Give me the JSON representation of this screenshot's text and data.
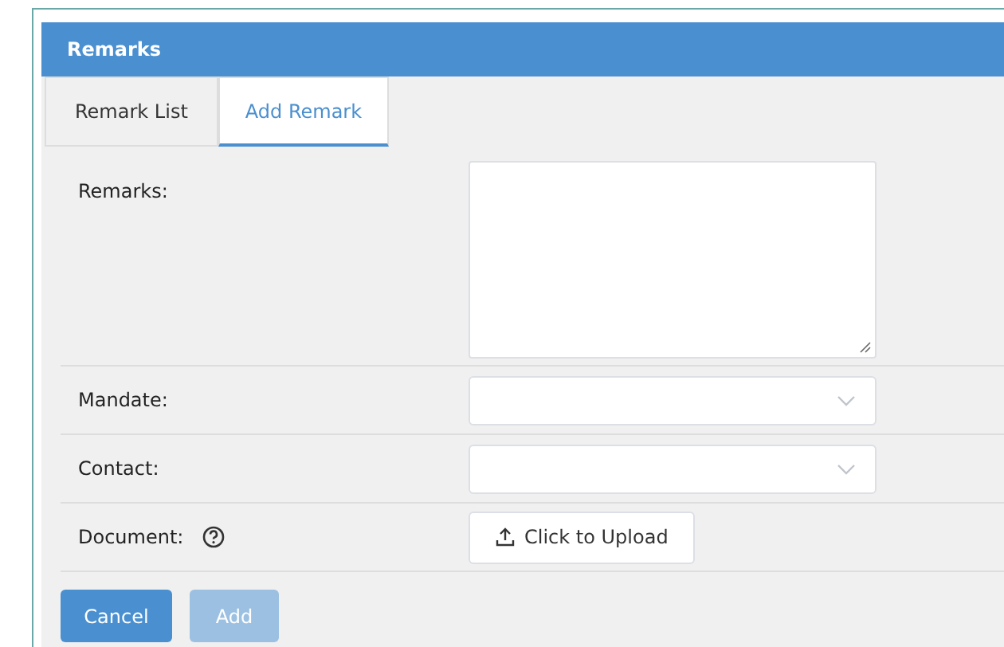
{
  "panel": {
    "title": "Remarks"
  },
  "tabs": [
    {
      "label": "Remark List",
      "selected": false
    },
    {
      "label": "Add Remark",
      "selected": true
    }
  ],
  "form": {
    "fields": [
      {
        "kind": "textarea",
        "label": "Remarks:"
      },
      {
        "kind": "select",
        "label": "Mandate:"
      },
      {
        "kind": "select",
        "label": "Contact:"
      },
      {
        "kind": "upload",
        "label": "Document:",
        "help": true,
        "button": "Click to Upload"
      }
    ]
  },
  "buttons": [
    {
      "label": "Cancel",
      "disabled": false
    },
    {
      "label": "Add",
      "disabled": true
    }
  ]
}
